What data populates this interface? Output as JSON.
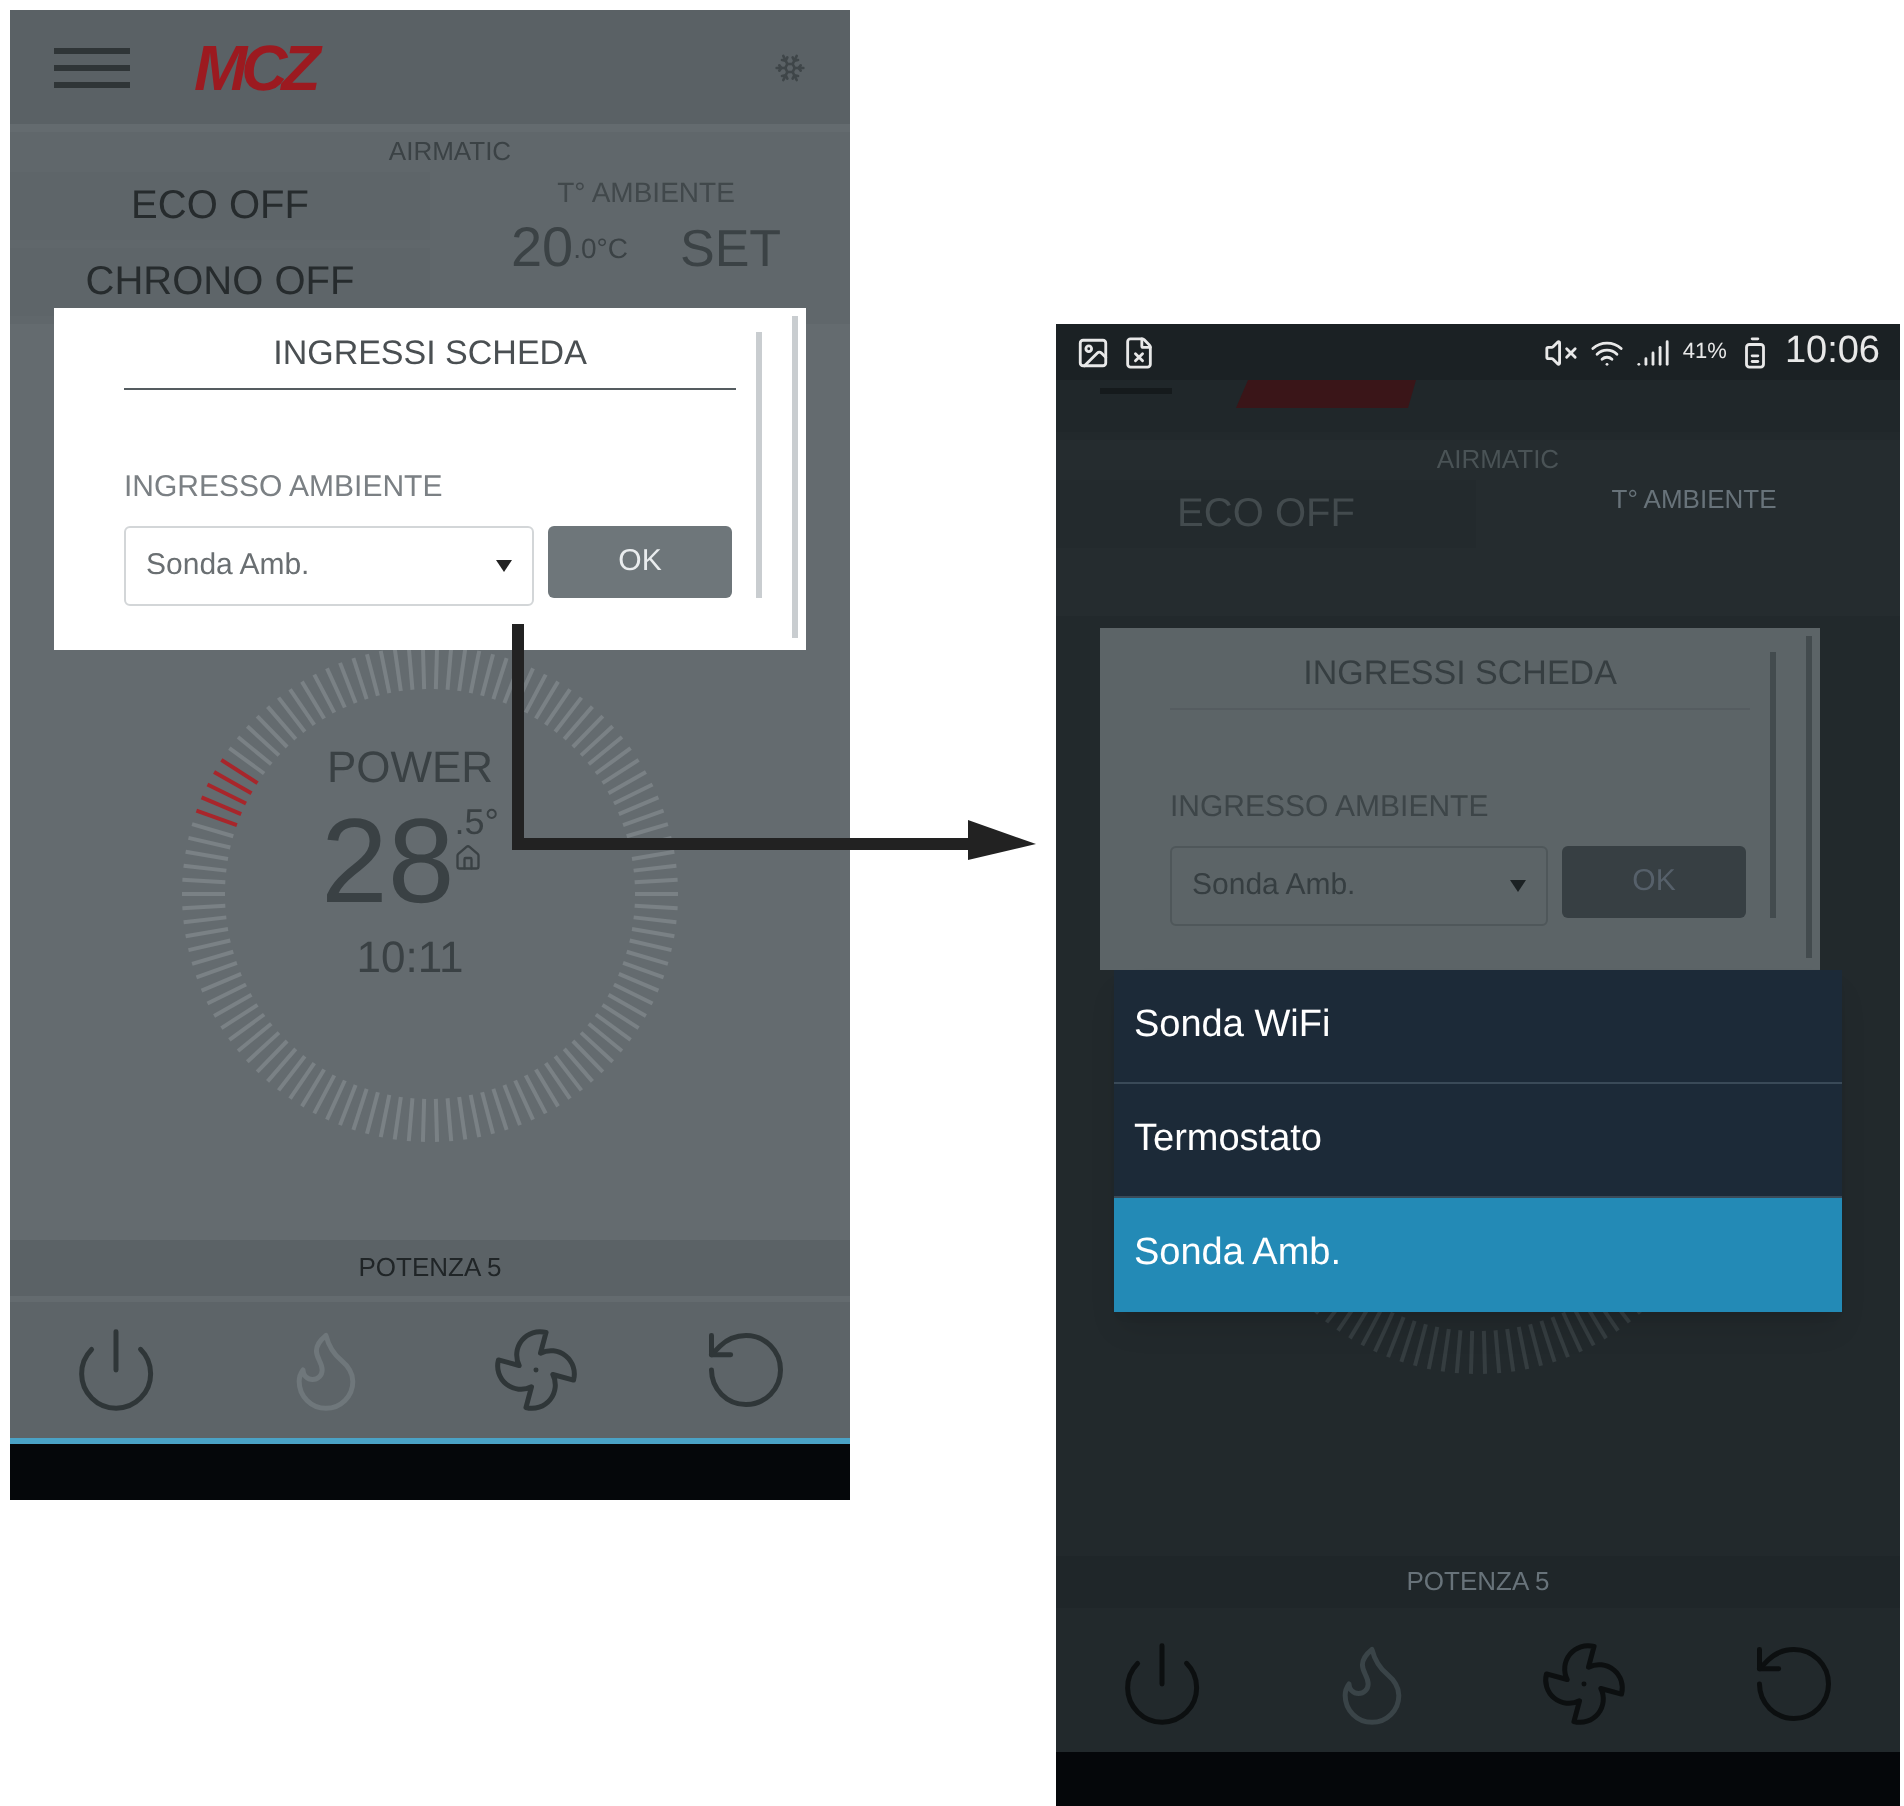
{
  "left_screen": {
    "logo": "MCZ",
    "mode": "AIRMATIC",
    "eco": "ECO OFF",
    "chrono": "CHRONO OFF",
    "ambient_label": "T° AMBIENTE",
    "ambient_temp": "20",
    "ambient_unit": ".0°C",
    "set": "SET",
    "dialog": {
      "title": "INGRESSI SCHEDA",
      "field_label": "INGRESSO AMBIENTE",
      "value": "Sonda Amb.",
      "ok": "OK"
    },
    "gauge": {
      "label": "POWER",
      "temp": "28",
      "temp_decimal": ".5°",
      "time": "10:11"
    },
    "power_level": "POTENZA 5",
    "controls": [
      {
        "kind": "power",
        "disabled": false
      },
      {
        "kind": "flame",
        "disabled": true
      },
      {
        "kind": "fan",
        "disabled": false
      },
      {
        "kind": "reset",
        "disabled": false
      }
    ]
  },
  "right_screen": {
    "status_bar": {
      "battery": "41%",
      "time": "10:06"
    },
    "mode": "AIRMATIC",
    "eco": "ECO OFF",
    "ambient_label": "T° AMBIENTE",
    "dialog": {
      "title": "INGRESSI SCHEDA",
      "field_label": "INGRESSO AMBIENTE",
      "value": "Sonda Amb.",
      "ok": "OK"
    },
    "dropdown": [
      {
        "label": "Sonda WiFi",
        "selected": false
      },
      {
        "label": "Termostato",
        "selected": false
      },
      {
        "label": "Sonda Amb.",
        "selected": true
      }
    ],
    "power_level": "POTENZA 5",
    "controls": [
      {
        "kind": "power",
        "disabled": false
      },
      {
        "kind": "flame",
        "disabled": true
      },
      {
        "kind": "fan",
        "disabled": false
      },
      {
        "kind": "reset",
        "disabled": false
      }
    ]
  }
}
